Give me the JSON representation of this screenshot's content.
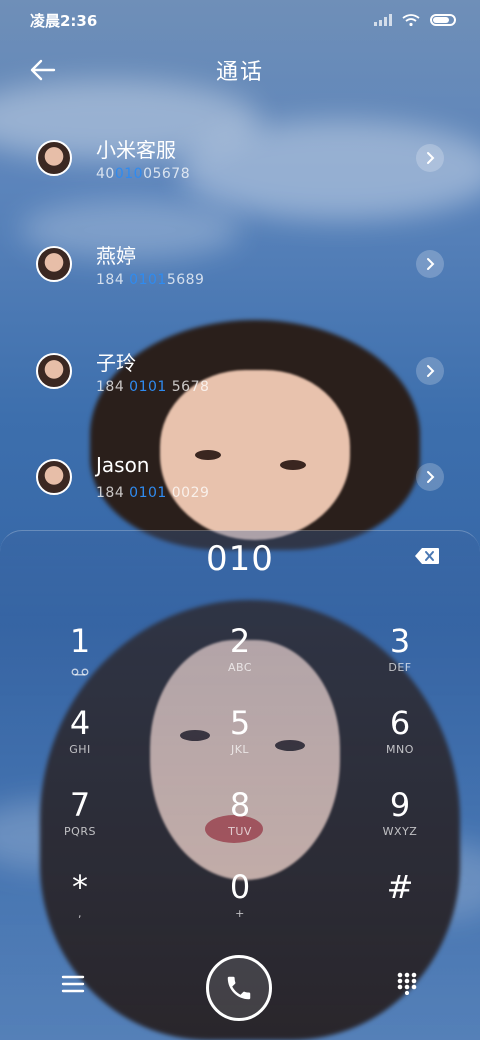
{
  "status_bar": {
    "time": "凌晨2:36"
  },
  "header": {
    "title": "通话"
  },
  "contacts": [
    {
      "name": "小米客服",
      "num_pre": "40",
      "num_hl": "010",
      "num_post": "05678"
    },
    {
      "name": "燕婷",
      "num_pre": "184 ",
      "num_hl": "0101",
      "num_post": "5689"
    },
    {
      "name": "子玲",
      "num_pre": "184 ",
      "num_hl": "0101",
      "num_post": " 5678"
    },
    {
      "name": "Jason",
      "num_pre": "184 ",
      "num_hl": "0101",
      "num_post": " 0029"
    }
  ],
  "dialpad": {
    "entered_number": "010",
    "keys": [
      {
        "digit": "1",
        "letters": ""
      },
      {
        "digit": "2",
        "letters": "ABC"
      },
      {
        "digit": "3",
        "letters": "DEF"
      },
      {
        "digit": "4",
        "letters": "GHI"
      },
      {
        "digit": "5",
        "letters": "JKL"
      },
      {
        "digit": "6",
        "letters": "MNO"
      },
      {
        "digit": "7",
        "letters": "PQRS"
      },
      {
        "digit": "8",
        "letters": "TUV"
      },
      {
        "digit": "9",
        "letters": "WXYZ"
      },
      {
        "digit": "*",
        "letters": ","
      },
      {
        "digit": "0",
        "letters": "+"
      },
      {
        "digit": "#",
        "letters": ""
      }
    ]
  },
  "icons": {
    "back": "arrow-left-icon",
    "chevron": "chevron-right-icon",
    "backspace": "backspace-icon",
    "voicemail": "voicemail-icon",
    "menu": "menu-icon",
    "call": "phone-icon",
    "keypad": "keypad-icon"
  },
  "colors": {
    "highlight": "#2f8bf0"
  }
}
